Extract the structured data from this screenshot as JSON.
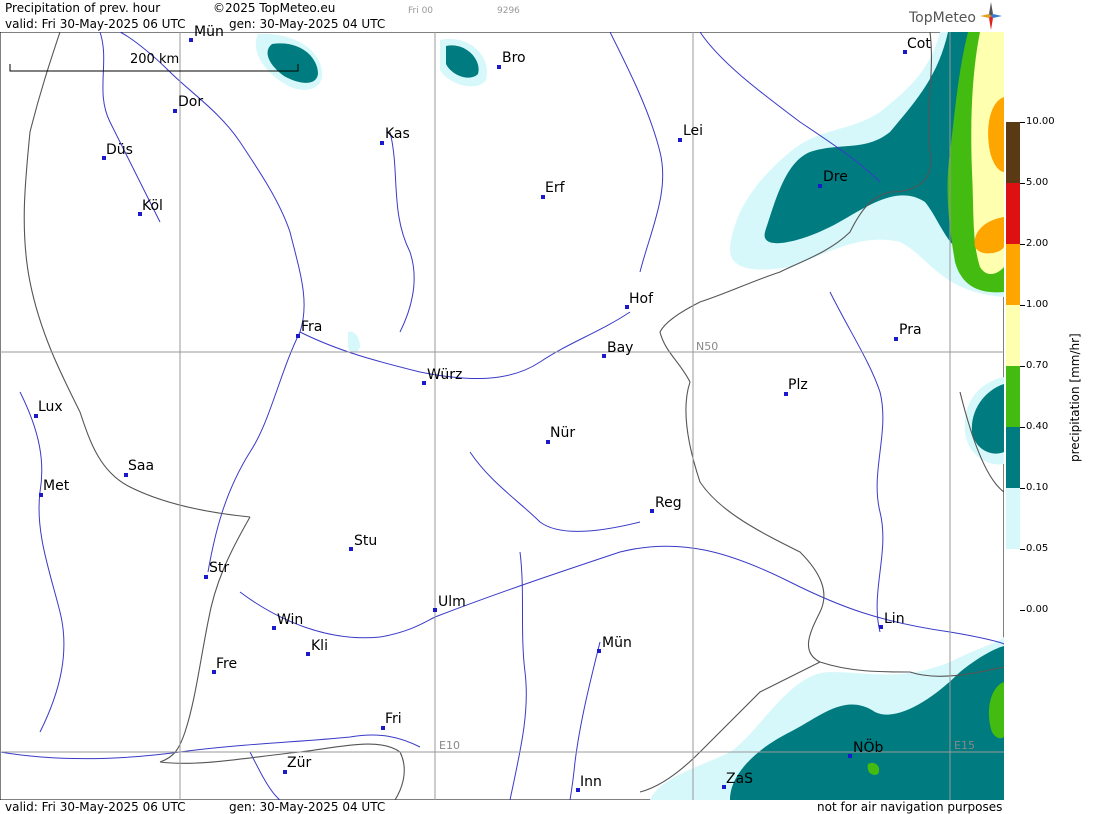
{
  "header": {
    "title": "Precipitation of prev. hour",
    "copyright": "©2025 TopMeteo.eu",
    "valid": "valid:  Fri  30-May-2025  06 UTC",
    "gen": "gen: 30-May-2025 04 UTC",
    "run": "Fri 00",
    "code": "9296",
    "logo": "TopMeteo"
  },
  "footer": {
    "valid": "valid:  Fri  30-May-2025  06 UTC",
    "gen": "gen: 30-May-2025 04 UTC",
    "notice": "not for air navigation purposes"
  },
  "map": {
    "scale_label": "200 km",
    "grid_labels": [
      "N50",
      "E10",
      "E15"
    ],
    "cities": [
      {
        "name": "Mün",
        "id": "munster"
      },
      {
        "name": "Bro",
        "id": "brocken"
      },
      {
        "name": "Cot",
        "id": "cottbus"
      },
      {
        "name": "Dor",
        "id": "dortmund"
      },
      {
        "name": "Kas",
        "id": "kassel"
      },
      {
        "name": "Lei",
        "id": "leipzig"
      },
      {
        "name": "Düs",
        "id": "dusseldorf"
      },
      {
        "name": "Erf",
        "id": "erfurt"
      },
      {
        "name": "Dre",
        "id": "dresden"
      },
      {
        "name": "Köl",
        "id": "koln"
      },
      {
        "name": "Hof",
        "id": "hof"
      },
      {
        "name": "Fra",
        "id": "frankfurt"
      },
      {
        "name": "Pra",
        "id": "praha"
      },
      {
        "name": "Bay",
        "id": "bayreuth"
      },
      {
        "name": "Würz",
        "id": "wurzburg"
      },
      {
        "name": "Plz",
        "id": "plzen"
      },
      {
        "name": "Lux",
        "id": "luxembourg"
      },
      {
        "name": "Nür",
        "id": "nurnberg"
      },
      {
        "name": "Saa",
        "id": "saarbrucken"
      },
      {
        "name": "Met",
        "id": "metz"
      },
      {
        "name": "Reg",
        "id": "regensburg"
      },
      {
        "name": "Stu",
        "id": "stuttgart"
      },
      {
        "name": "Str",
        "id": "strasbourg"
      },
      {
        "name": "Ulm",
        "id": "ulm"
      },
      {
        "name": "Lin",
        "id": "linz"
      },
      {
        "name": "Win",
        "id": "winterlingen"
      },
      {
        "name": "Kli",
        "id": "klippeneck"
      },
      {
        "name": "Mün",
        "id": "munchen"
      },
      {
        "name": "Fre",
        "id": "freiburg"
      },
      {
        "name": "Fri",
        "id": "friedrichshafen"
      },
      {
        "name": "NÖb",
        "id": "noeb"
      },
      {
        "name": "Zür",
        "id": "zurich"
      },
      {
        "name": "Inn",
        "id": "innsbruck"
      },
      {
        "name": "ZaS",
        "id": "zell-am-see"
      }
    ]
  },
  "legend": {
    "title": "precipitation [mm/hr]",
    "levels": [
      {
        "label": "10.00",
        "color": "#5a3a14"
      },
      {
        "label": "5.00",
        "color": "#dd1111"
      },
      {
        "label": "2.00",
        "color": "#ffa500"
      },
      {
        "label": "1.00",
        "color": "#ffffb0"
      },
      {
        "label": "0.70",
        "color": "#44bb11"
      },
      {
        "label": "0.40",
        "color": "#007b80"
      },
      {
        "label": "0.10",
        "color": "#d6f8fa"
      },
      {
        "label": "0.05",
        "color": "#ffffff"
      },
      {
        "label": "0.00",
        "color": "#ffffff"
      }
    ]
  }
}
